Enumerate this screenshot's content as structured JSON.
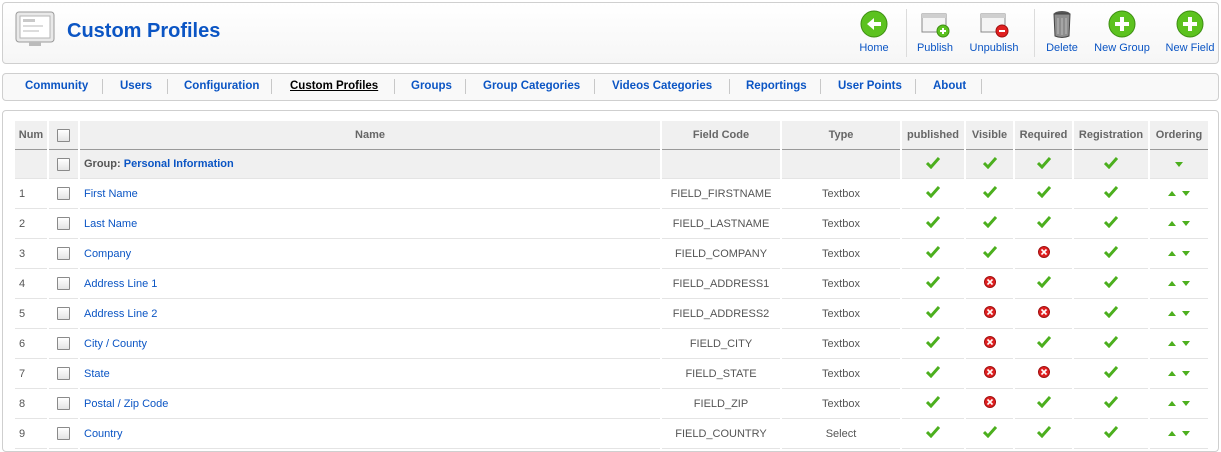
{
  "header": {
    "title": "Custom Profiles"
  },
  "toolbar": [
    {
      "key": "home",
      "label": "Home",
      "icon": "home-icon"
    },
    {
      "key": "publish",
      "label": "Publish",
      "icon": "publish-icon"
    },
    {
      "key": "unpublish",
      "label": "Unpublish",
      "icon": "unpublish-icon"
    },
    {
      "key": "delete",
      "label": "Delete",
      "icon": "trash-icon"
    },
    {
      "key": "new_group",
      "label": "New Group",
      "icon": "add-group-icon"
    },
    {
      "key": "new_field",
      "label": "New Field",
      "icon": "add-field-icon"
    }
  ],
  "submenu": [
    {
      "label": "Community"
    },
    {
      "label": "Users"
    },
    {
      "label": "Configuration"
    },
    {
      "label": "Custom Profiles",
      "active": true
    },
    {
      "label": "Groups"
    },
    {
      "label": "Group Categories"
    },
    {
      "label": "Videos Categories"
    },
    {
      "label": "Reportings"
    },
    {
      "label": "User Points"
    },
    {
      "label": "About"
    }
  ],
  "table": {
    "columns": {
      "num": "Num",
      "name": "Name",
      "code": "Field Code",
      "type": "Type",
      "published": "published",
      "visible": "Visible",
      "required": "Required",
      "registration": "Registration",
      "ordering": "Ordering"
    },
    "group": {
      "label": "Group:",
      "name": "Personal Information"
    },
    "rows": [
      {
        "num": "1",
        "name": "First Name",
        "code": "FIELD_FIRSTNAME",
        "type": "Textbox",
        "published": true,
        "visible": true,
        "required": true,
        "registration": true
      },
      {
        "num": "2",
        "name": "Last Name",
        "code": "FIELD_LASTNAME",
        "type": "Textbox",
        "published": true,
        "visible": true,
        "required": true,
        "registration": true
      },
      {
        "num": "3",
        "name": "Company",
        "code": "FIELD_COMPANY",
        "type": "Textbox",
        "published": true,
        "visible": true,
        "required": false,
        "registration": true
      },
      {
        "num": "4",
        "name": "Address Line 1",
        "code": "FIELD_ADDRESS1",
        "type": "Textbox",
        "published": true,
        "visible": false,
        "required": true,
        "registration": true
      },
      {
        "num": "5",
        "name": "Address Line 2",
        "code": "FIELD_ADDRESS2",
        "type": "Textbox",
        "published": true,
        "visible": false,
        "required": false,
        "registration": true
      },
      {
        "num": "6",
        "name": "City / County",
        "code": "FIELD_CITY",
        "type": "Textbox",
        "published": true,
        "visible": false,
        "required": true,
        "registration": true
      },
      {
        "num": "7",
        "name": "State",
        "code": "FIELD_STATE",
        "type": "Textbox",
        "published": true,
        "visible": false,
        "required": false,
        "registration": true
      },
      {
        "num": "8",
        "name": "Postal / Zip Code",
        "code": "FIELD_ZIP",
        "type": "Textbox",
        "published": true,
        "visible": false,
        "required": true,
        "registration": true
      },
      {
        "num": "9",
        "name": "Country",
        "code": "FIELD_COUNTRY",
        "type": "Select",
        "published": true,
        "visible": true,
        "required": true,
        "registration": true
      }
    ]
  },
  "colors": {
    "accent": "#0b55c4",
    "check": "#4caf1e",
    "cross": "#e02020"
  }
}
